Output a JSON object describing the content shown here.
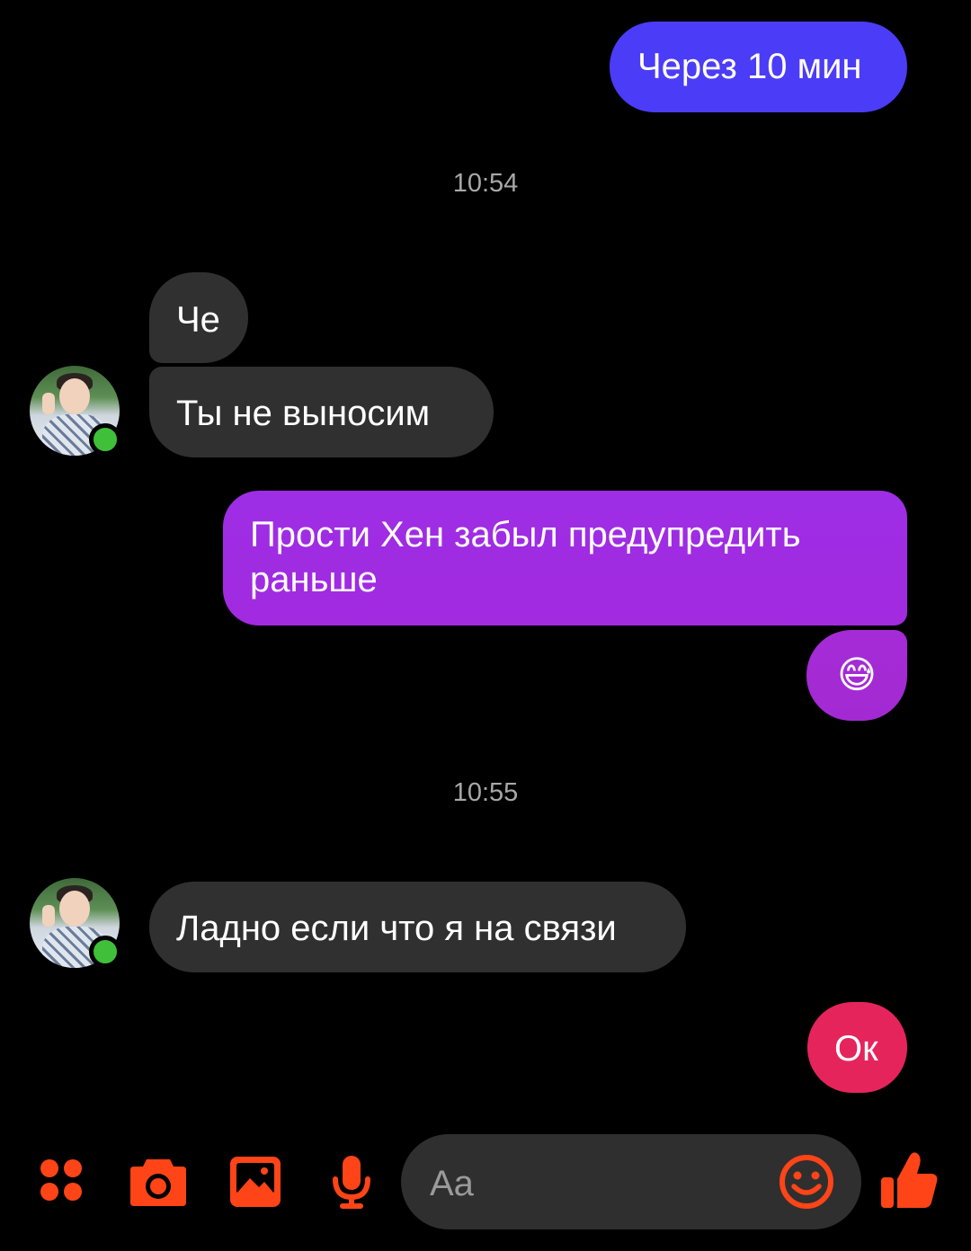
{
  "messages": [
    {
      "from": "me",
      "text": "Через 10 мин"
    },
    {
      "from": "them",
      "text": "Че"
    },
    {
      "from": "them",
      "text": "Ты не выносим"
    },
    {
      "from": "me",
      "text_line1": "Прости Хен забыл предупредить",
      "text_line2": "раньше"
    },
    {
      "from": "me",
      "emoji": "😅"
    },
    {
      "from": "them",
      "text": "Ладно если что я на связи"
    },
    {
      "from": "me",
      "text": "Ок"
    }
  ],
  "timestamps": [
    "10:54",
    "10:55"
  ],
  "composer": {
    "placeholder": "Aa"
  },
  "toolbar": {
    "icons": [
      "menu-icon",
      "camera-icon",
      "gallery-icon",
      "microphone-icon",
      "emoji-icon",
      "thumbs-up-icon"
    ]
  },
  "colors": {
    "accent": "#ff4417",
    "sent_blue": "#4b3cf7",
    "sent_purple": "#a02ae2",
    "sent_pink": "#e6245c",
    "received": "#303030",
    "online": "#3fbf3a"
  }
}
